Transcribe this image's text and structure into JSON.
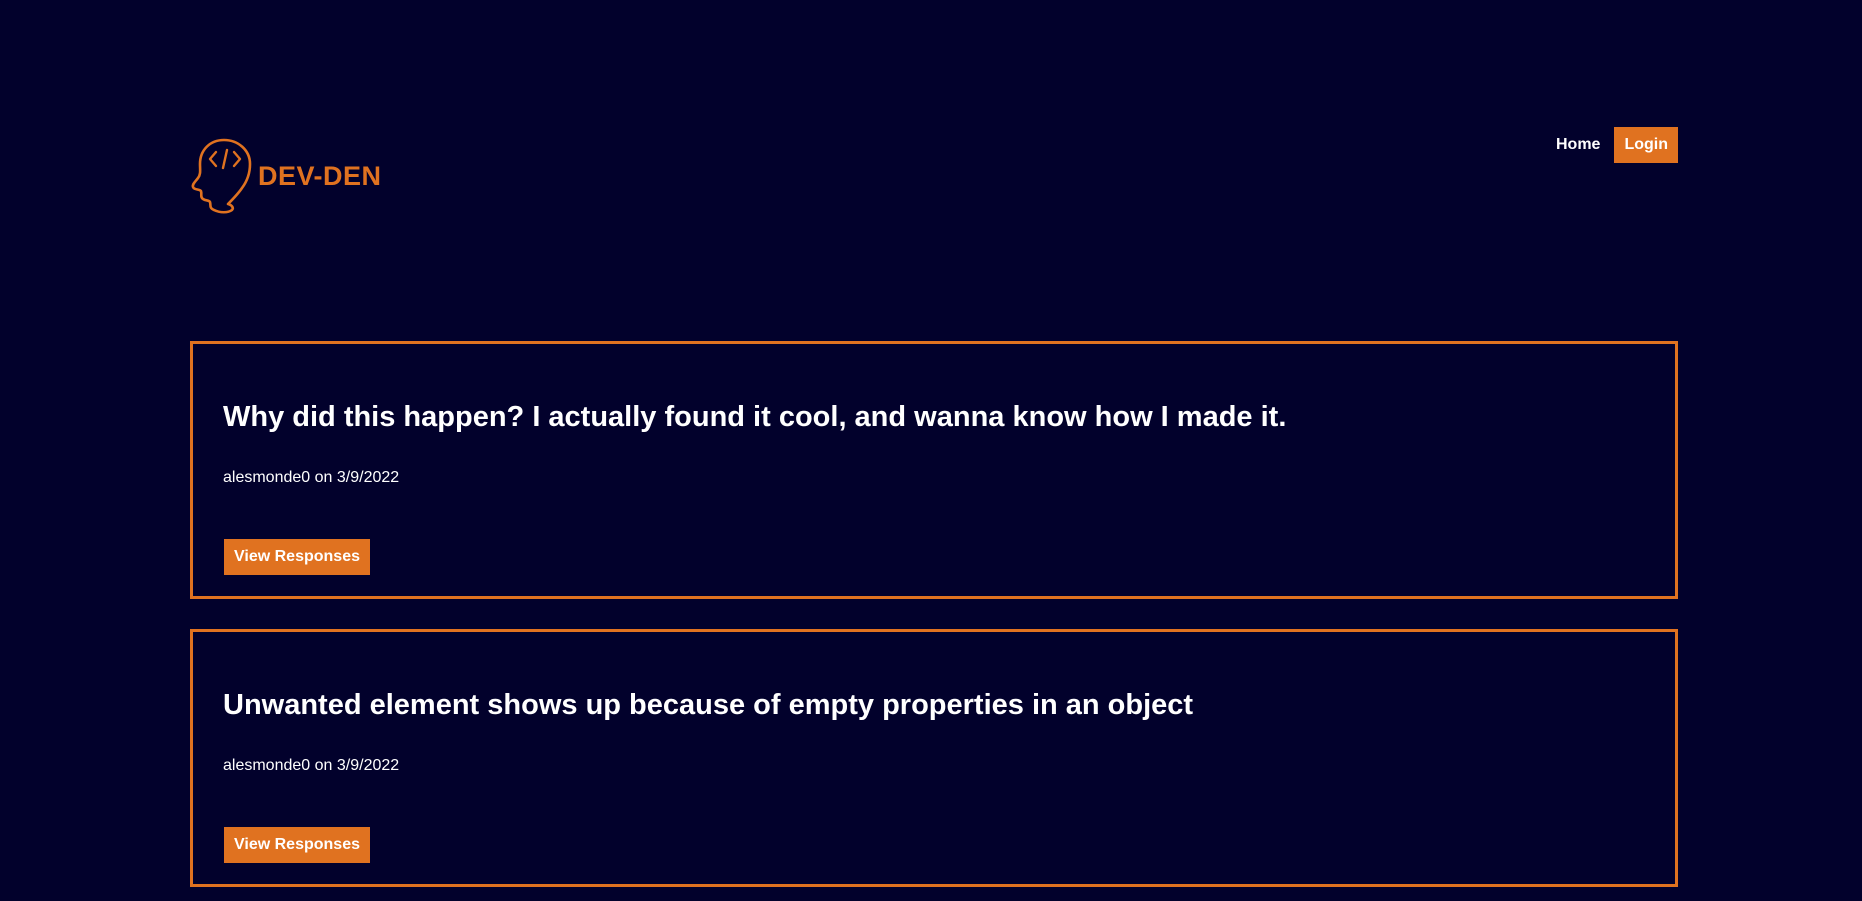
{
  "header": {
    "logo_text": "DEV-DEN",
    "nav": {
      "home_label": "Home",
      "login_label": "Login"
    }
  },
  "posts": [
    {
      "title": "Why did this happen? I actually found it cool, and wanna know how I made it.",
      "author": "alesmonde0",
      "on_label": "on",
      "date": "3/9/2022",
      "button_label": "View Responses"
    },
    {
      "title": "Unwanted element shows up because of empty properties in an object",
      "author": "alesmonde0",
      "on_label": "on",
      "date": "3/9/2022",
      "button_label": "View Responses"
    }
  ],
  "colors": {
    "background": "#02012c",
    "accent": "#e07220",
    "text": "#ffffff"
  },
  "icons": {
    "logo_icon": "head-code-icon"
  }
}
